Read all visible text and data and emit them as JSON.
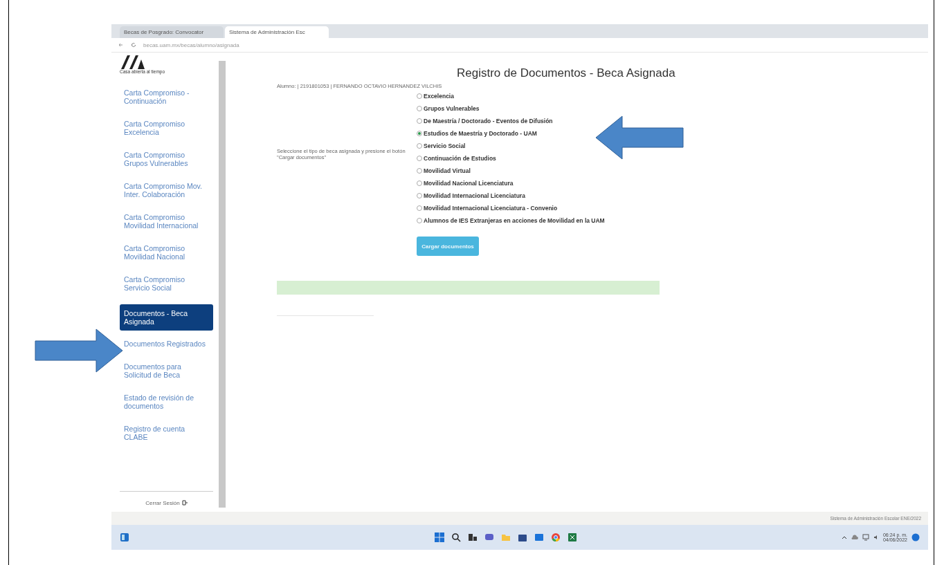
{
  "browser": {
    "tabs": [
      {
        "title": "Becas de Posgrado: Convocator",
        "selected": false
      },
      {
        "title": "Sistema de Administración Esc",
        "selected": true
      }
    ],
    "url": "becas.uam.mx/becas/alumno/asignada"
  },
  "sidebar": {
    "logo_caption": "Casa abierta al tiempo",
    "items": [
      {
        "label": "Carta Compromiso - Continuación",
        "selected": false
      },
      {
        "label": "Carta Compromiso Excelencia",
        "selected": false
      },
      {
        "label": "Carta Compromiso Grupos Vulnerables",
        "selected": false
      },
      {
        "label": "Carta Compromiso Mov. Inter. Colaboración",
        "selected": false
      },
      {
        "label": "Carta Compromiso Movilidad Internacional",
        "selected": false
      },
      {
        "label": "Carta Compromiso Movilidad Nacional",
        "selected": false
      },
      {
        "label": "Carta Compromiso Servicio Social",
        "selected": false
      },
      {
        "label": "Documentos - Beca Asignada",
        "selected": true
      },
      {
        "label": "Documentos Registrados",
        "selected": false
      },
      {
        "label": "Documentos para Solicitud de Beca",
        "selected": false
      },
      {
        "label": "Estado de revisión de documentos",
        "selected": false
      },
      {
        "label": "Registro de cuenta CLABE",
        "selected": false
      }
    ],
    "logout": "Cerrar Sesión"
  },
  "content": {
    "title": "Registro de Documentos - Beca Asignada",
    "student": "Alumno: | 2191801053 | FERNANDO OCTAVIO HERNANDEZ VILCHIS",
    "instruction": "Seleccione el tipo de beca asignada y presione el botón \"Cargar documentos\"",
    "options": [
      {
        "label": "Excelencia",
        "selected": false
      },
      {
        "label": "Grupos Vulnerables",
        "selected": false
      },
      {
        "label": "De Maestría / Doctorado - Eventos de Difusión",
        "selected": false
      },
      {
        "label": "Estudios de Maestría y Doctorado - UAM",
        "selected": true
      },
      {
        "label": "Servicio Social",
        "selected": false
      },
      {
        "label": "Continuación de Estudios",
        "selected": false
      },
      {
        "label": "Movilidad Virtual",
        "selected": false
      },
      {
        "label": "Movilidad Nacional Licenciatura",
        "selected": false
      },
      {
        "label": "Movilidad Internacional Licenciatura",
        "selected": false
      },
      {
        "label": "Movilidad Internacional Licenciatura - Convenio",
        "selected": false
      },
      {
        "label": "Alumnos de IES Extranjeras en acciones de Movilidad en la UAM",
        "selected": false
      }
    ],
    "button": "Cargar documentos"
  },
  "status_bar": "Sistema de Administración Escolar ENE/2022",
  "taskbar": {
    "time": "06:24 p. m.",
    "date": "04/06/2022"
  }
}
